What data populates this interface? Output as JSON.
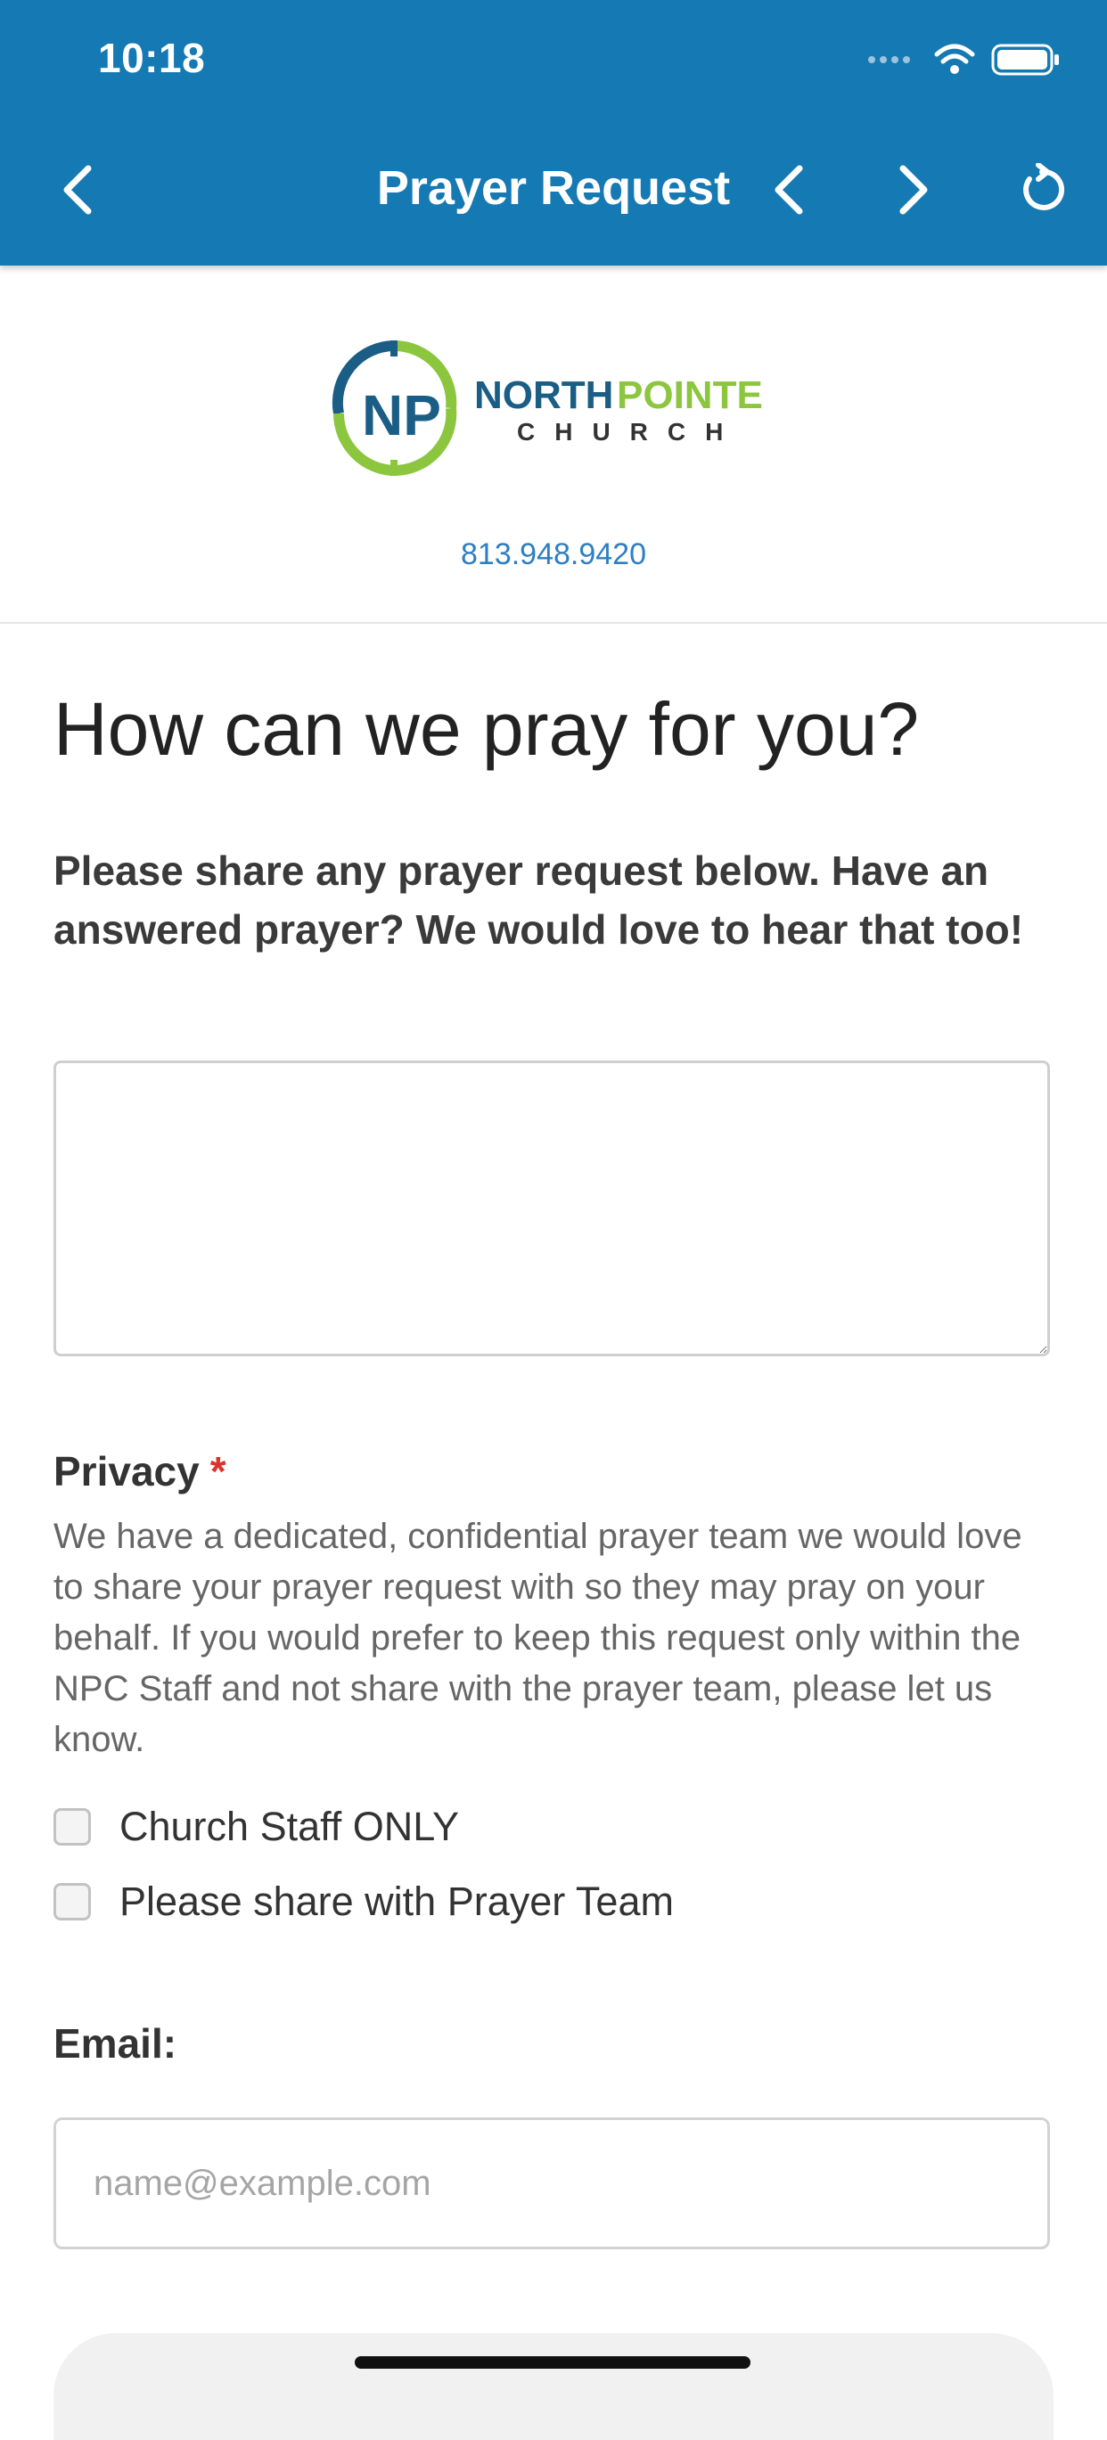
{
  "status_bar": {
    "time": "10:18"
  },
  "nav": {
    "title": "Prayer Request"
  },
  "logo": {
    "wordmark_top_1": "NORTH",
    "wordmark_top_2": "POINTE",
    "wordmark_bottom": "CHURCH",
    "monogram": "NP",
    "colors": {
      "blue": "#1a5d85",
      "green": "#8cc63f"
    }
  },
  "contact": {
    "phone": "813.948.9420"
  },
  "form": {
    "heading": "How can we pray for you?",
    "lead": "Please share any prayer request below. Have an answered prayer? We would love to hear that too!",
    "prayer_textarea": {
      "value": ""
    },
    "privacy": {
      "label": "Privacy",
      "required_mark": "*",
      "description": "We have a dedicated, confidential prayer team we would love to share your prayer request with so they may pray on your behalf. If you would prefer to keep this request only within the NPC Staff and not share with the prayer team, please let us know.",
      "options": [
        {
          "label": "Church Staff ONLY",
          "checked": false
        },
        {
          "label": "Please share with Prayer Team",
          "checked": false
        }
      ]
    },
    "email": {
      "label": "Email:",
      "placeholder": "name@example.com",
      "value": ""
    }
  },
  "theme": {
    "header_bg": "#1579b3",
    "link": "#2e7fc2",
    "required": "#d9342b"
  }
}
